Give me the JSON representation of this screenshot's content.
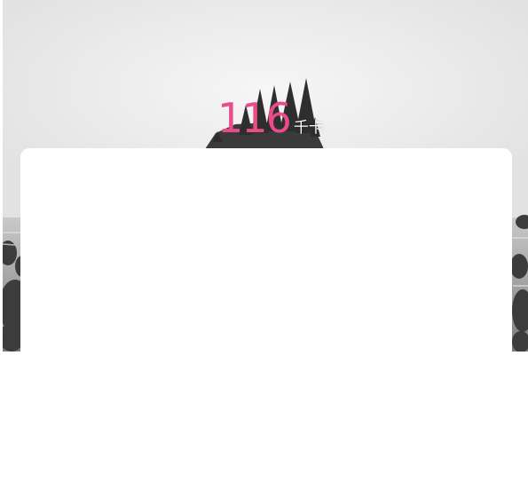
{
  "summary": {
    "calories_value": "116",
    "calories_unit": "千卡"
  },
  "colors": {
    "accent": "#ea4c89",
    "card_background": "#ffffff"
  },
  "hero": {
    "image": "grayscale-sea-stack-with-trees-photo"
  }
}
